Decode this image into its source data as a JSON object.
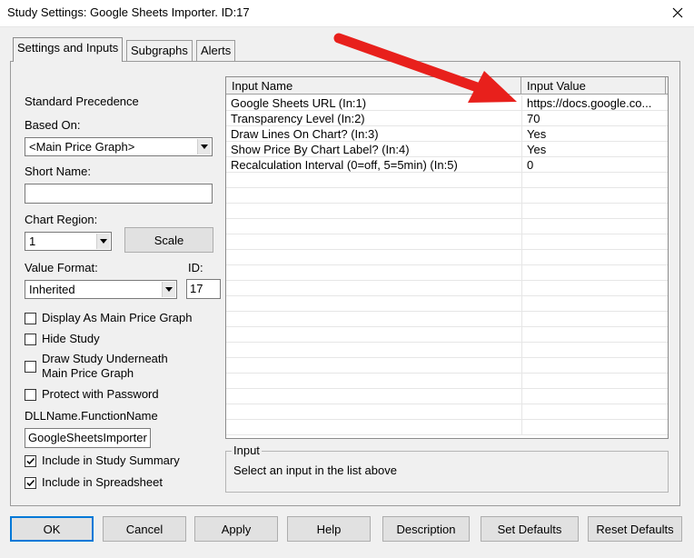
{
  "window": {
    "title": "Study Settings: Google Sheets Importer. ID:17"
  },
  "tabs": [
    {
      "label": "Settings and Inputs",
      "active": true
    },
    {
      "label": "Subgraphs",
      "active": false
    },
    {
      "label": "Alerts",
      "active": false
    }
  ],
  "left": {
    "standard_precedence": "Standard Precedence",
    "based_on_label": "Based On:",
    "based_on_value": "<Main Price Graph>",
    "short_name_label": "Short Name:",
    "short_name_value": "",
    "chart_region_label": "Chart Region:",
    "chart_region_value": "1",
    "scale_label": "Scale",
    "value_format_label": "Value Format:",
    "value_format_value": "Inherited",
    "id_label": "ID:",
    "id_value": "17",
    "checkboxes": [
      {
        "label": "Display As Main Price Graph",
        "checked": false
      },
      {
        "label": "Hide Study",
        "checked": false
      },
      {
        "label": "Draw Study Underneath",
        "label2": "Main Price Graph",
        "checked": false
      },
      {
        "label": "Protect with Password",
        "checked": false
      }
    ],
    "dll_label": "DLLName.FunctionName",
    "dll_value": "GoogleSheetsImporter",
    "include_summary": {
      "label": "Include in Study Summary",
      "checked": true
    },
    "include_spreadsheet": {
      "label": "Include in Spreadsheet",
      "checked": true
    }
  },
  "inputs_table": {
    "headers": [
      "Input Name",
      "Input Value"
    ],
    "rows": [
      {
        "name": "Google Sheets URL  (In:1)",
        "value": "https://docs.google.co..."
      },
      {
        "name": "Transparency Level  (In:2)",
        "value": "70"
      },
      {
        "name": "Draw Lines On Chart?  (In:3)",
        "value": "Yes"
      },
      {
        "name": "Show Price By Chart Label?  (In:4)",
        "value": "Yes"
      },
      {
        "name": "Recalculation Interval (0=off, 5=5min)  (In:5)",
        "value": "0"
      }
    ]
  },
  "input_group": {
    "legend": "Input",
    "description": "Select an input in the list above"
  },
  "buttons": {
    "ok": "OK",
    "cancel": "Cancel",
    "apply": "Apply",
    "help": "Help",
    "description": "Description",
    "set_defaults": "Set Defaults",
    "reset_defaults": "Reset Defaults"
  },
  "colors": {
    "annotation_arrow": "#e8201c"
  }
}
